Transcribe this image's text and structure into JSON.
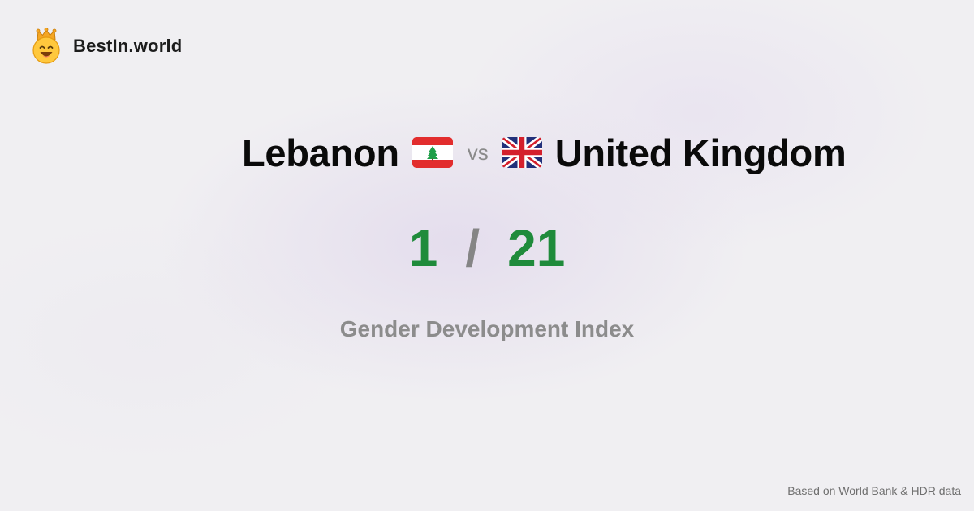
{
  "brand": {
    "name": "BestIn.world",
    "logo_icon": "smiling-crown-face-icon"
  },
  "comparison": {
    "left": {
      "country": "Lebanon",
      "flag_icon": "lebanon-flag-icon",
      "rank": "1"
    },
    "vs_label": "vs",
    "right": {
      "country": "United Kingdom",
      "flag_icon": "united-kingdom-flag-icon",
      "rank": "21"
    },
    "separator": "/",
    "metric": "Gender Development Index"
  },
  "footer": {
    "source": "Based on World Bank & HDR data"
  },
  "colors": {
    "rank_green": "#1f8b3b",
    "muted_gray": "#8c8c8c",
    "background": "#f0eff2"
  }
}
